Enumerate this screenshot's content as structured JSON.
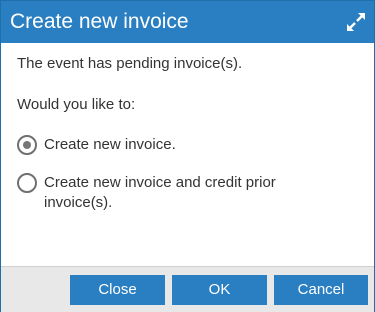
{
  "dialog": {
    "title": "Create new invoice",
    "expand_icon": "expand-arrows-icon",
    "message": "The event has pending invoice(s).",
    "prompt": "Would you like to:",
    "options": [
      {
        "label": "Create new invoice.",
        "selected": true
      },
      {
        "label": "Create new invoice and credit prior invoice(s).",
        "selected": false
      }
    ],
    "buttons": {
      "close": "Close",
      "ok": "OK",
      "cancel": "Cancel"
    }
  },
  "colors": {
    "accent": "#2a7ec2",
    "footer_bg": "#e8e8e8",
    "text": "#333333"
  }
}
